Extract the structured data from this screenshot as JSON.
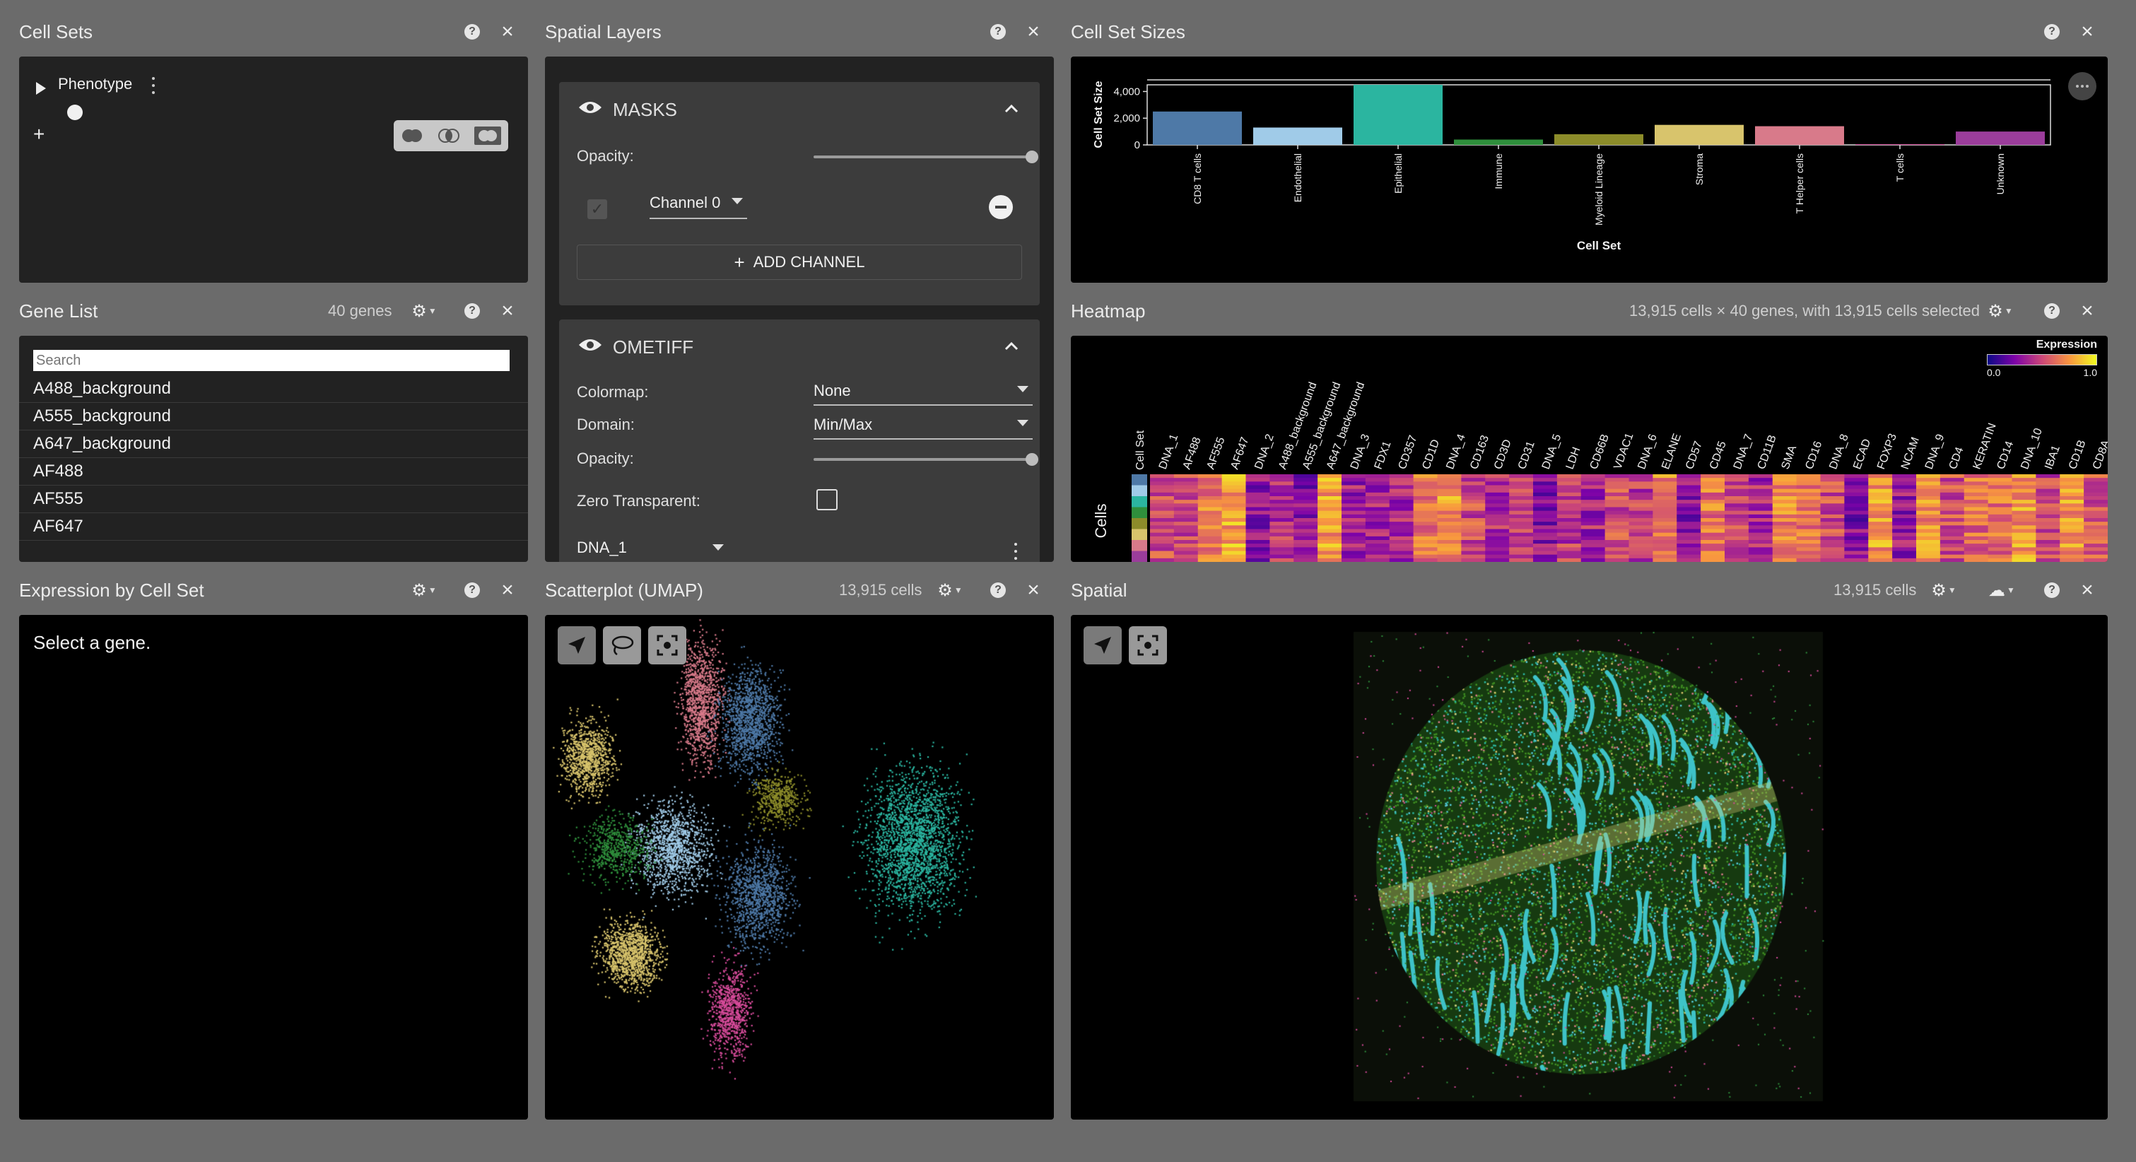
{
  "cell_sets": {
    "title": "Cell Sets",
    "tree_item": "Phenotype",
    "add": "+"
  },
  "spatial_layers": {
    "title": "Spatial Layers",
    "masks": {
      "name": "MASKS",
      "opacity_label": "Opacity:",
      "channel_label": "Channel 0",
      "add_channel": "ADD CHANNEL"
    },
    "ometiff": {
      "name": "OMETIFF",
      "colormap_label": "Colormap:",
      "colormap_value": "None",
      "domain_label": "Domain:",
      "domain_value": "Min/Max",
      "opacity_label": "Opacity:",
      "zero_label": "Zero Transparent:",
      "channel_select": "DNA_1"
    }
  },
  "cell_set_sizes": {
    "title": "Cell Set Sizes"
  },
  "chart_data": {
    "type": "bar",
    "xlabel": "Cell Set",
    "ylabel": "Cell Set Size",
    "ylim": [
      0,
      4500
    ],
    "yticks": [
      "4,000",
      "2,000",
      "0"
    ],
    "categories": [
      "CD8 T cells",
      "Endothelial",
      "Epithelial",
      "Immune",
      "Myeloid Lineage",
      "Stroma",
      "T Helper cells",
      "T cells",
      "Unknown"
    ],
    "values": [
      2500,
      1300,
      4500,
      400,
      800,
      1500,
      1400,
      50,
      1000
    ],
    "colors": [
      "#4e79a7",
      "#a0cbe8",
      "#2bb5a0",
      "#2f8f3c",
      "#8c8c2a",
      "#d8c46c",
      "#d87a8a",
      "#d64b9a",
      "#9b3d9b"
    ],
    "grid": false
  },
  "gene_list": {
    "title": "Gene List",
    "count": "40 genes",
    "search_placeholder": "Search",
    "genes": [
      "A488_background",
      "A555_background",
      "A647_background",
      "AF488",
      "AF555",
      "AF647"
    ]
  },
  "heatmap": {
    "title": "Heatmap",
    "summary": "13,915 cells × 40 genes, with 13,915 cells selected",
    "legend_title": "Expression",
    "legend_min": "0.0",
    "legend_max": "1.0",
    "row_label": "Cells",
    "cellset_label": "Cell Set",
    "genes": [
      "DNA_1",
      "AF488",
      "AF555",
      "AF647",
      "DNA_2",
      "A488_background",
      "A555_background",
      "A647_background",
      "DNA_3",
      "FDX1",
      "CD357",
      "CD1D",
      "DNA_4",
      "CD163",
      "CD3D",
      "CD31",
      "DNA_5",
      "LDH",
      "CD66B",
      "VDAC1",
      "DNA_6",
      "ELANE",
      "CD57",
      "CD45",
      "DNA_7",
      "CD11B",
      "SMA",
      "CD16",
      "DNA_8",
      "ECAD",
      "FOXP3",
      "NCAM",
      "DNA_9",
      "CD4",
      "KERATIN",
      "CD14",
      "DNA_10",
      "IBA1",
      "CD1B",
      "CD8A"
    ]
  },
  "expression_by_cell_set": {
    "title": "Expression by Cell Set",
    "message": "Select a gene."
  },
  "scatterplot": {
    "title": "Scatterplot (UMAP)",
    "count": "13,915 cells"
  },
  "spatial": {
    "title": "Spatial",
    "count": "13,915 cells"
  },
  "colors": {
    "app_bg": "#6b6b6b",
    "panel_bg": "#000000",
    "card_bg": "#3c3c3c"
  }
}
